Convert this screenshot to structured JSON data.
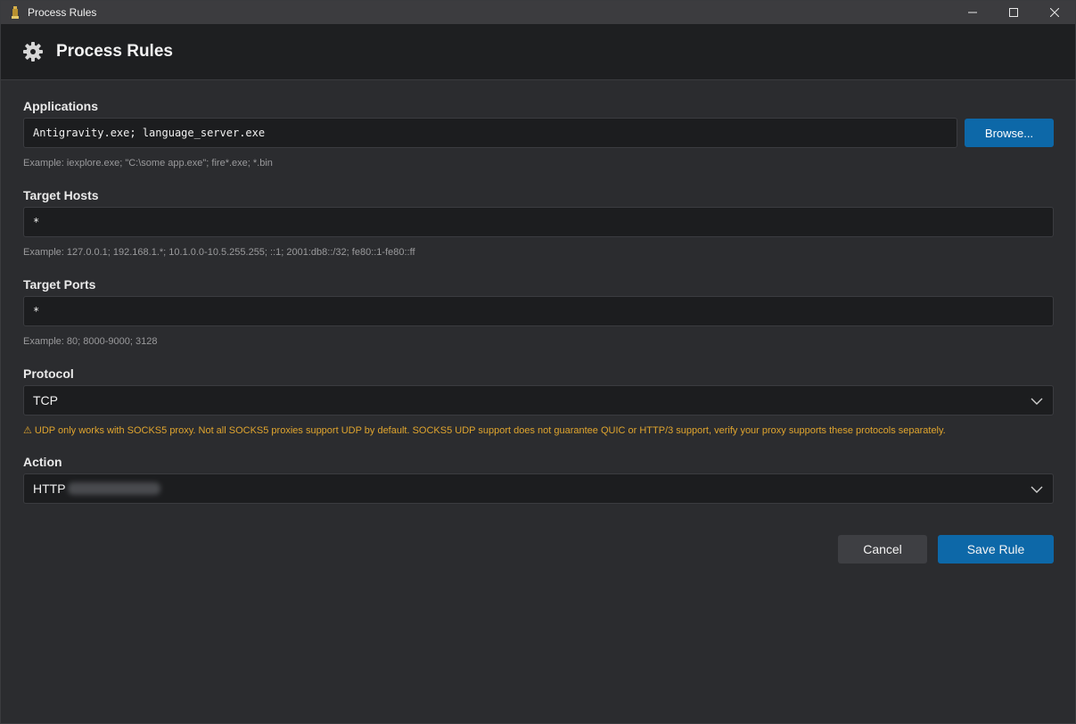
{
  "window": {
    "title": "Process Rules"
  },
  "header": {
    "title": "Process Rules"
  },
  "applications": {
    "label": "Applications",
    "value": "Antigravity.exe; language_server.exe",
    "browse_label": "Browse...",
    "hint": "Example: iexplore.exe; \"C:\\some app.exe\"; fire*.exe; *.bin"
  },
  "target_hosts": {
    "label": "Target Hosts",
    "value": "*",
    "hint": "Example: 127.0.0.1; 192.168.1.*; 10.1.0.0-10.5.255.255; ::1; 2001:db8::/32; fe80::1-fe80::ff"
  },
  "target_ports": {
    "label": "Target Ports",
    "value": "*",
    "hint": "Example: 80; 8000-9000; 3128"
  },
  "protocol": {
    "label": "Protocol",
    "selected": "TCP",
    "warning": "⚠ UDP only works with SOCKS5 proxy. Not all SOCKS5 proxies support UDP by default. SOCKS5 UDP support does not guarantee QUIC or HTTP/3 support, verify your proxy supports these protocols separately."
  },
  "action": {
    "label": "Action",
    "selected_prefix": "HTTP"
  },
  "buttons": {
    "cancel": "Cancel",
    "save": "Save Rule"
  },
  "colors": {
    "accent": "#0d68a8",
    "warning": "#e0a52e",
    "background": "#2b2c2f",
    "header": "#1e1f21"
  }
}
